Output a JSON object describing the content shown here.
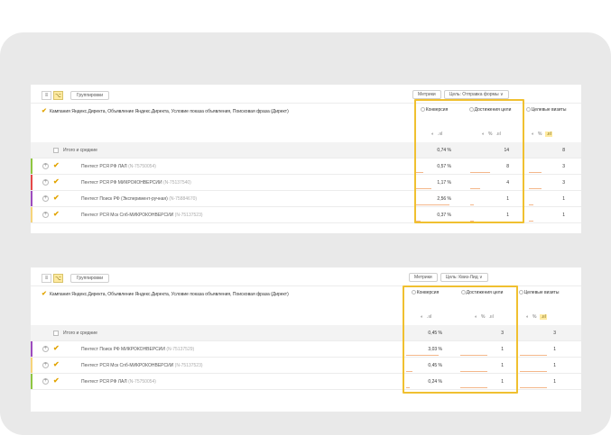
{
  "panels": [
    {
      "toolbar": {
        "view_list": "≡",
        "view_tree": "⌥",
        "group_label": "Группировки"
      },
      "metrics_label": "Метрики",
      "goal_label": "Цель: Отправка формы ∨",
      "header_title": "Кампания Яндекс.Директа, Объявление Яндекс.Директа, Условие показа объявления, Поисковая фраза (Директ)",
      "columns": {
        "conversion": "Конверсия",
        "achievements": "Достижения цели",
        "visits": "Целевые визиты",
        "sub1": [
          "◐",
          ".ııl"
        ],
        "sub2": [
          "◐",
          "%",
          ".ııl"
        ],
        "sub3": [
          "◐",
          "%",
          ".ııl"
        ]
      },
      "total": {
        "label": "Итого и средние",
        "conversion": "0,74 %",
        "achievements": "14",
        "visits": "8"
      },
      "rows": [
        {
          "name": "Пентест РСЯ РФ ЛАЛ",
          "id": "(N-75750054)",
          "conversion": "0,57 %",
          "achievements": "8",
          "visits": "3",
          "stripe": "#8fc641"
        },
        {
          "name": "Пентест РСЯ РФ МИКРОКОНВЕРСИИ",
          "id": "(N-75137540)",
          "conversion": "1,17 %",
          "achievements": "4",
          "visits": "3",
          "stripe": "#e54848"
        },
        {
          "name": "Пентест Поиск РФ (Эксперимент-ручная)",
          "id": "(N-75884670)",
          "conversion": "2,56 %",
          "achievements": "1",
          "visits": "1",
          "stripe": "#9d4bbf"
        },
        {
          "name": "Пентест РСЯ Мск Спб-МИКРОКОНВЕРСИИ",
          "id": "(N-75137523)",
          "conversion": "0,37 %",
          "achievements": "1",
          "visits": "1",
          "stripe": "#f6d47a"
        }
      ]
    },
    {
      "toolbar": {
        "view_list": "≡",
        "view_tree": "⌥",
        "group_label": "Группировки"
      },
      "metrics_label": "Метрики",
      "goal_label": "Цель: Квиз-Лид ∨",
      "header_title": "Кампания Яндекс.Директа, Объявление Яндекс.Директа, Условие показа объявления, Поисковая фраза (Директ)",
      "columns": {
        "conversion": "Конверсия",
        "achievements": "Достижения цели",
        "visits": "Целевые визиты",
        "sub1": [
          "◐",
          ".ııl"
        ],
        "sub2": [
          "◐",
          "%",
          ".ııl"
        ],
        "sub3": [
          "◐",
          "%",
          ".ııl"
        ]
      },
      "total": {
        "label": "Итого и средние",
        "conversion": "0,45 %",
        "achievements": "3",
        "visits": "3"
      },
      "rows": [
        {
          "name": "Пентест Поиск РФ МИКРОКОНВЕРСИИ",
          "id": "(N-75137529)",
          "conversion": "3,03 %",
          "achievements": "1",
          "visits": "1",
          "stripe": "#9d4bbf"
        },
        {
          "name": "Пентест РСЯ Мск Спб-МИКРОКОНВЕРСИИ",
          "id": "(N-75137523)",
          "conversion": "0,45 %",
          "achievements": "1",
          "visits": "1",
          "stripe": "#f6d47a"
        },
        {
          "name": "Пентест РСЯ РФ ЛАЛ",
          "id": "(N-75750054)",
          "conversion": "0,24 %",
          "achievements": "1",
          "visits": "1",
          "stripe": "#8fc641"
        }
      ]
    }
  ],
  "colors": {
    "accent": "#f0c030",
    "check": "#e2a400",
    "bar": "#f4b78a"
  }
}
